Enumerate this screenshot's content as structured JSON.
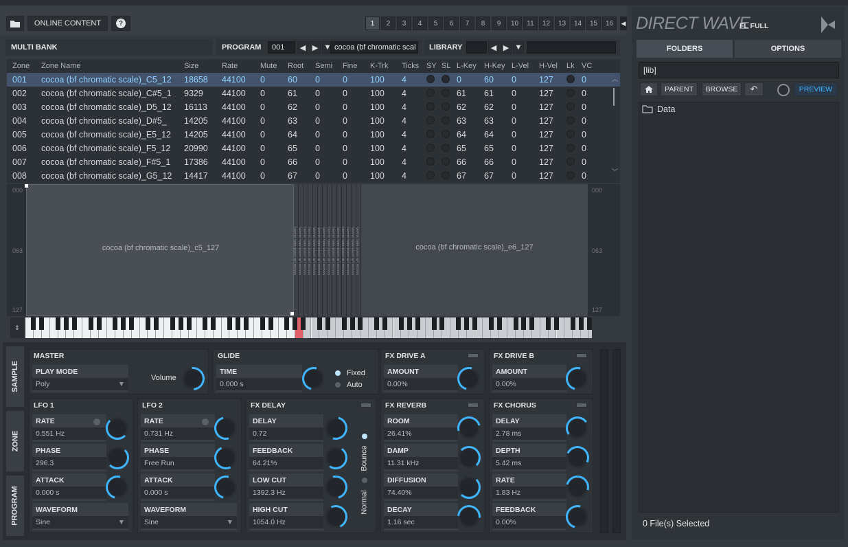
{
  "toolbar": {
    "online_content": "ONLINE CONTENT",
    "pages": [
      "1",
      "2",
      "3",
      "4",
      "5",
      "6",
      "7",
      "8",
      "9",
      "10",
      "11",
      "12",
      "13",
      "14",
      "15",
      "16"
    ],
    "active_page": "1"
  },
  "header": {
    "multi_bank": "MULTI BANK",
    "program_label": "PROGRAM",
    "program_number": "001",
    "program_name": "cocoa (bf chromatic scal",
    "library_label": "LIBRARY"
  },
  "table": {
    "columns": [
      "Zone",
      "Zone Name",
      "Size",
      "Rate",
      "Mute",
      "Root",
      "Semi",
      "Fine",
      "K-Trk",
      "Ticks",
      "SY",
      "SL",
      "L-Key",
      "H-Key",
      "L-Vel",
      "H-Vel",
      "Lk",
      "VC"
    ],
    "rows": [
      {
        "zone": "001",
        "name": "cocoa (bf chromatic scale)_C5_12",
        "size": "18658",
        "rate": "44100",
        "mute": "0",
        "root": "60",
        "semi": "0",
        "fine": "0",
        "ktrk": "100",
        "ticks": "4",
        "lkey": "0",
        "hkey": "60",
        "lvel": "0",
        "hvel": "127",
        "vc": "0"
      },
      {
        "zone": "002",
        "name": "cocoa (bf chromatic scale)_C#5_1",
        "size": "9329",
        "rate": "44100",
        "mute": "0",
        "root": "61",
        "semi": "0",
        "fine": "0",
        "ktrk": "100",
        "ticks": "4",
        "lkey": "61",
        "hkey": "61",
        "lvel": "0",
        "hvel": "127",
        "vc": "0"
      },
      {
        "zone": "003",
        "name": "cocoa (bf chromatic scale)_D5_12",
        "size": "16113",
        "rate": "44100",
        "mute": "0",
        "root": "62",
        "semi": "0",
        "fine": "0",
        "ktrk": "100",
        "ticks": "4",
        "lkey": "62",
        "hkey": "62",
        "lvel": "0",
        "hvel": "127",
        "vc": "0"
      },
      {
        "zone": "004",
        "name": "cocoa (bf chromatic scale)_D#5_",
        "size": "14205",
        "rate": "44100",
        "mute": "0",
        "root": "63",
        "semi": "0",
        "fine": "0",
        "ktrk": "100",
        "ticks": "4",
        "lkey": "63",
        "hkey": "63",
        "lvel": "0",
        "hvel": "127",
        "vc": "0"
      },
      {
        "zone": "005",
        "name": "cocoa (bf chromatic scale)_E5_12",
        "size": "14205",
        "rate": "44100",
        "mute": "0",
        "root": "64",
        "semi": "0",
        "fine": "0",
        "ktrk": "100",
        "ticks": "4",
        "lkey": "64",
        "hkey": "64",
        "lvel": "0",
        "hvel": "127",
        "vc": "0"
      },
      {
        "zone": "006",
        "name": "cocoa (bf chromatic scale)_F5_12",
        "size": "20990",
        "rate": "44100",
        "mute": "0",
        "root": "65",
        "semi": "0",
        "fine": "0",
        "ktrk": "100",
        "ticks": "4",
        "lkey": "65",
        "hkey": "65",
        "lvel": "0",
        "hvel": "127",
        "vc": "0"
      },
      {
        "zone": "007",
        "name": "cocoa (bf chromatic scale)_F#5_1",
        "size": "17386",
        "rate": "44100",
        "mute": "0",
        "root": "66",
        "semi": "0",
        "fine": "0",
        "ktrk": "100",
        "ticks": "4",
        "lkey": "66",
        "hkey": "66",
        "lvel": "0",
        "hvel": "127",
        "vc": "0"
      },
      {
        "zone": "008",
        "name": "cocoa (bf chromatic scale)_G5_12",
        "size": "14417",
        "rate": "44100",
        "mute": "0",
        "root": "67",
        "semi": "0",
        "fine": "0",
        "ktrk": "100",
        "ticks": "4",
        "lkey": "67",
        "hkey": "67",
        "lvel": "0",
        "hvel": "127",
        "vc": "0"
      }
    ]
  },
  "zonemap": {
    "left_label": "cocoa (bf chromatic scale)_c5_127",
    "right_label": "cocoa (bf chromatic scale)_e6_127",
    "vel_top": "000",
    "vel_mid": "063",
    "vel_bottom": "127",
    "stripe_text": "cocoa (bf chromatic scale)"
  },
  "sidetabs": {
    "sample": "SAMPLE",
    "zone": "ZONE",
    "program": "PROGRAM"
  },
  "master": {
    "title": "MASTER",
    "play_mode_label": "PLAY MODE",
    "play_mode": "Poly",
    "volume_label": "Volume"
  },
  "glide": {
    "title": "GLIDE",
    "time_label": "TIME",
    "time": "0.000 s",
    "fixed": "Fixed",
    "auto": "Auto"
  },
  "fx_drive_a": {
    "title": "FX DRIVE A",
    "amount_label": "AMOUNT",
    "amount": "0.00%"
  },
  "fx_drive_b": {
    "title": "FX DRIVE B",
    "amount_label": "AMOUNT",
    "amount": "0.00%"
  },
  "lfo1": {
    "title": "LFO 1",
    "rate_label": "RATE",
    "rate": "0.551 Hz",
    "phase_label": "PHASE",
    "phase": "296.3",
    "attack_label": "ATTACK",
    "attack": "0.000 s",
    "waveform_label": "WAVEFORM",
    "waveform": "Sine"
  },
  "lfo2": {
    "title": "LFO 2",
    "rate_label": "RATE",
    "rate": "0.731 Hz",
    "phase_label": "PHASE",
    "phase": "Free Run",
    "attack_label": "ATTACK",
    "attack": "0.000 s",
    "waveform_label": "WAVEFORM",
    "waveform": "Sine"
  },
  "fx_delay": {
    "title": "FX DELAY",
    "delay_label": "DELAY",
    "delay": "0.72",
    "feedback_label": "FEEDBACK",
    "feedback": "64.21%",
    "lowcut_label": "LOW CUT",
    "lowcut": "1392.3 Hz",
    "highcut_label": "HIGH CUT",
    "highcut": "1054.0 Hz",
    "bounce": "Bounce",
    "normal": "Normal"
  },
  "fx_reverb": {
    "title": "FX REVERB",
    "room_label": "ROOM",
    "room": "26.41%",
    "damp_label": "DAMP",
    "damp": "11.31 kHz",
    "diffusion_label": "DIFFUSION",
    "diffusion": "74.40%",
    "decay_label": "DECAY",
    "decay": "1.16 sec"
  },
  "fx_chorus": {
    "title": "FX CHORUS",
    "delay_label": "DELAY",
    "delay": "2.78 ms",
    "depth_label": "DEPTH",
    "depth": "5.42 ms",
    "rate_label": "RATE",
    "rate": "1.83 Hz",
    "feedback_label": "FEEDBACK",
    "feedback": "0.00%"
  },
  "browser": {
    "title": "DIRECT WAVE",
    "edition": "FL FULL",
    "tab_folders": "FOLDERS",
    "tab_options": "OPTIONS",
    "path": "[lib]",
    "parent": "PARENT",
    "browse": "BROWSE",
    "preview": "PREVIEW",
    "folder": "Data",
    "status": "0 File(s) Selected"
  },
  "colors": {
    "accent": "#3fb4ff",
    "selection": "#43536b",
    "background": "#353a40",
    "key_highlight": "#e0606a"
  }
}
